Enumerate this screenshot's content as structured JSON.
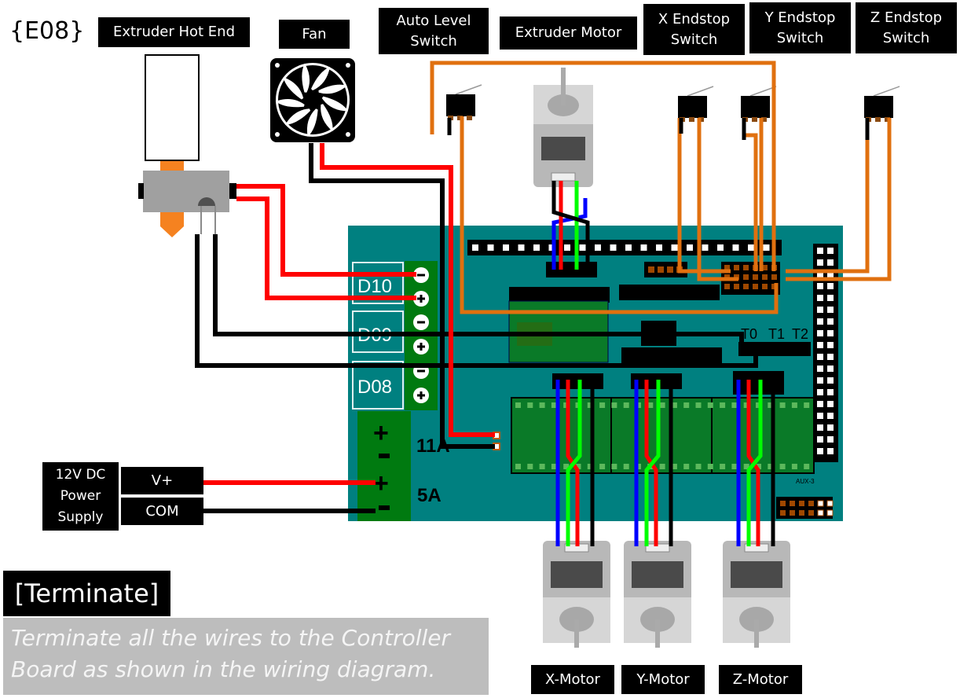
{
  "step": {
    "id": "{E08}"
  },
  "components": {
    "extruder_hot_end": "Extruder Hot End",
    "fan": "Fan",
    "auto_level_switch": "Auto Level\nSwitch",
    "extruder_motor": "Extruder Motor",
    "x_endstop": "X Endstop\nSwitch",
    "y_endstop": "Y Endstop\nSwitch",
    "z_endstop": "Z Endstop\nSwitch",
    "x_motor": "X-Motor",
    "y_motor": "Y-Motor",
    "z_motor": "Z-Motor"
  },
  "power_supply": {
    "name": "12V DC\nPower\nSupply",
    "terminals": [
      "V+",
      "COM"
    ]
  },
  "board": {
    "outputs": [
      "D10",
      "D09",
      "D08"
    ],
    "power_inputs": [
      "11A",
      "5A"
    ],
    "thermistor_headers": [
      "T0",
      "T1",
      "T2"
    ],
    "aux_label": "AUX-3"
  },
  "wire_colors": {
    "red": "#ff0000",
    "black": "#000000",
    "blue": "#0000ff",
    "green": "#00ff00",
    "orange": "#e0700f"
  },
  "board_color": "#008080",
  "instruction": {
    "title": "[Terminate]",
    "text": "Terminate all the wires to the Controller Board as shown in the wiring diagram."
  }
}
